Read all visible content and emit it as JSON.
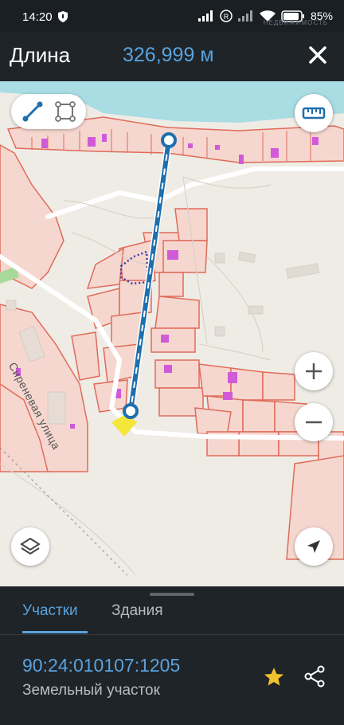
{
  "status_bar": {
    "time": "14:20",
    "battery": "85",
    "watermark": "НЕДВИЖИМОСТЬ"
  },
  "header": {
    "label": "Длина",
    "value": "326,999 м",
    "close_icon": "close-icon"
  },
  "map": {
    "street_label": "Сиреневая улица",
    "controls": {
      "line_mode_icon": "line-measure-icon",
      "area_mode_icon": "area-measure-icon",
      "ruler_icon": "ruler-icon",
      "zoom_in_icon": "plus-icon",
      "zoom_out_icon": "minus-icon",
      "layers_icon": "layers-icon",
      "location_icon": "navigation-arrow-icon"
    },
    "colors": {
      "water": "#a9dce3",
      "land": "#efece6",
      "parcel_fill": "#f6d7cf",
      "parcel_stroke": "#e06b5a",
      "building": "#d05ad8",
      "measure_line": "#1e6fae",
      "selected_parcel": "#f4e63a"
    }
  },
  "bottom_sheet": {
    "tabs": [
      {
        "label": "Участки",
        "active": true
      },
      {
        "label": "Здания",
        "active": false
      }
    ],
    "parcel": {
      "number": "90:24:010107:1205",
      "type": "Земельный участок"
    }
  }
}
